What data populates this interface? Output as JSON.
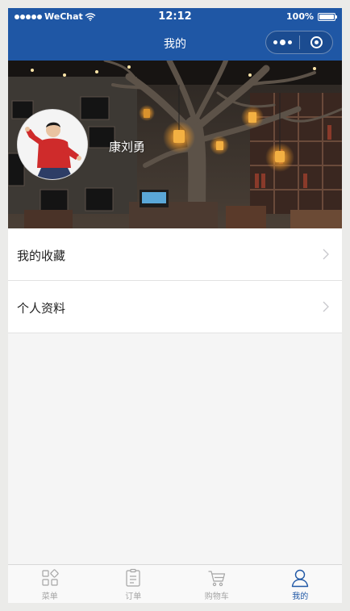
{
  "status_bar": {
    "carrier": "WeChat",
    "time": "12:12",
    "battery": "100%"
  },
  "nav": {
    "title": "我的"
  },
  "profile": {
    "username": "康刘勇"
  },
  "menu": {
    "items": [
      {
        "label": "我的收藏"
      },
      {
        "label": "个人资料"
      }
    ]
  },
  "tab_bar": {
    "tabs": [
      {
        "label": "菜单",
        "icon": "grid-icon",
        "active": false
      },
      {
        "label": "订单",
        "icon": "clipboard-icon",
        "active": false
      },
      {
        "label": "购物车",
        "icon": "cart-icon",
        "active": false
      },
      {
        "label": "我的",
        "icon": "user-icon",
        "active": true
      }
    ]
  },
  "colors": {
    "primary": "#1f57a5",
    "inactive": "#a5a5a5",
    "background": "#f5f5f5"
  }
}
